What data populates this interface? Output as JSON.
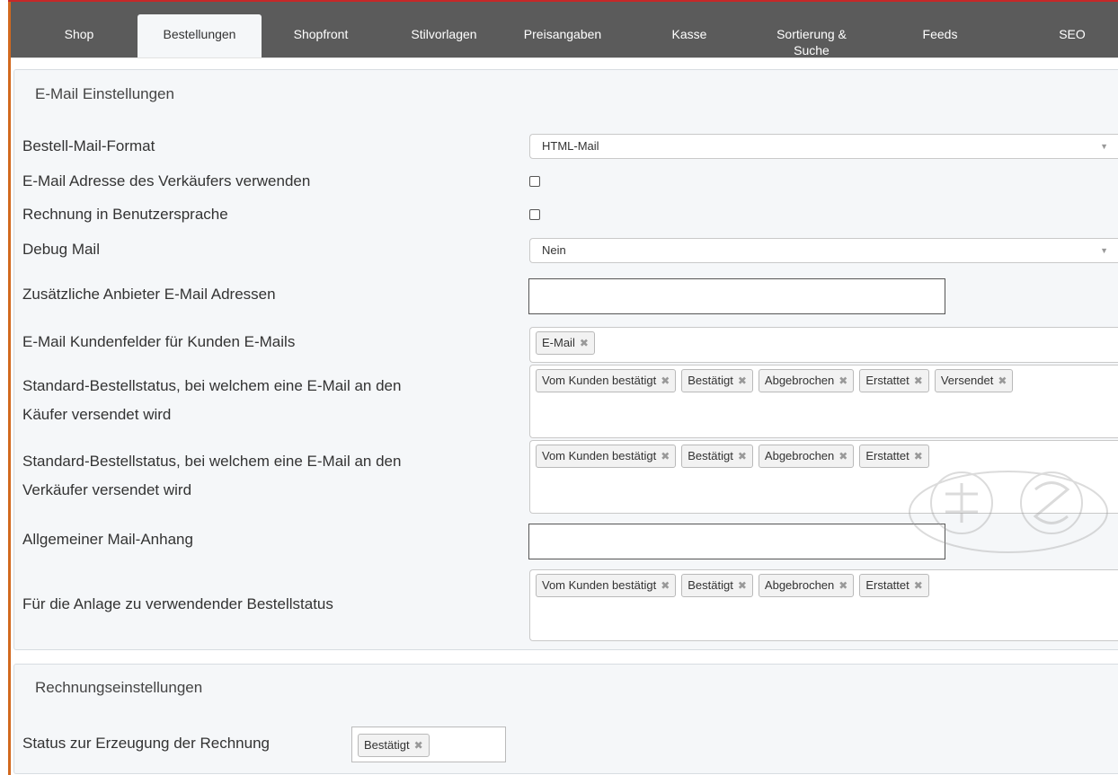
{
  "tabs": [
    {
      "label": "Shop",
      "active": false
    },
    {
      "label": "Bestellungen",
      "active": true
    },
    {
      "label": "Shopfront",
      "active": false
    },
    {
      "label": "Stilvorlagen",
      "active": false
    },
    {
      "label": "Preisangaben",
      "active": false
    },
    {
      "label": "Kasse",
      "active": false
    },
    {
      "label": "Sortierung & Suche",
      "active": false
    },
    {
      "label": "Feeds",
      "active": false
    },
    {
      "label": "SEO",
      "active": false
    }
  ],
  "email_section": {
    "title": "E-Mail Einstellungen",
    "fields": {
      "order_mail_format": {
        "label": "Bestell-Mail-Format",
        "value": "HTML-Mail"
      },
      "use_seller_email": {
        "label": "E-Mail Adresse des Verkäufers verwenden",
        "checked": false
      },
      "invoice_user_language": {
        "label": "Rechnung in Benutzersprache",
        "checked": false
      },
      "debug_mail": {
        "label": "Debug Mail",
        "value": "Nein"
      },
      "additional_emails": {
        "label": "Zusätzliche Anbieter E-Mail Adressen",
        "value": ""
      },
      "customer_fields": {
        "label": "E-Mail Kundenfelder für Kunden E-Mails",
        "tags": [
          "E-Mail"
        ]
      },
      "buyer_status": {
        "label_1": "Standard-Bestellstatus, bei welchem eine E-Mail an den",
        "label_2": "Käufer versendet wird",
        "tags": [
          "Vom Kunden bestätigt",
          "Bestätigt",
          "Abgebrochen",
          "Erstattet",
          "Versendet"
        ]
      },
      "seller_status": {
        "label_1": "Standard-Bestellstatus, bei welchem eine E-Mail an den",
        "label_2": "Verkäufer versendet wird",
        "tags": [
          "Vom Kunden bestätigt",
          "Bestätigt",
          "Abgebrochen",
          "Erstattet"
        ]
      },
      "general_attachment": {
        "label": "Allgemeiner Mail-Anhang",
        "value": ""
      },
      "attachment_status": {
        "label": "Für die Anlage zu verwendender Bestellstatus",
        "tags": [
          "Vom Kunden bestätigt",
          "Bestätigt",
          "Abgebrochen",
          "Erstattet"
        ]
      }
    }
  },
  "invoice_section": {
    "title": "Rechnungseinstellungen",
    "invoice_status": {
      "label": "Status zur Erzeugung der Rechnung",
      "tags": [
        "Bestätigt"
      ]
    }
  },
  "icons": {
    "remove": "✖",
    "caret": "▼"
  },
  "colors": {
    "tabbar": "#5b5b5b",
    "panel": "#f5f7f9",
    "accent_left": "#d2691e",
    "top_border": "#c62828"
  }
}
